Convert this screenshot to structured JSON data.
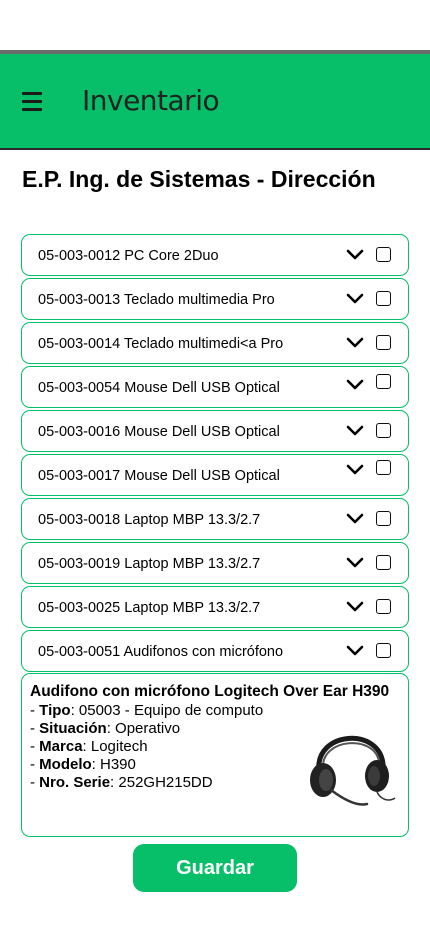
{
  "app": {
    "title": "Inventario"
  },
  "page": {
    "title": "E.P. Ing. de Sistemas - Dirección"
  },
  "items": [
    {
      "label": "05-003-0012 PC Core 2Duo"
    },
    {
      "label": "05-003-0013 Teclado multimedia Pro"
    },
    {
      "label": "05-003-0014 Teclado multimedi<a Pro"
    },
    {
      "label": "05-003-0054 Mouse Dell USB Optical"
    },
    {
      "label": "05-003-0016 Mouse Dell USB Optical"
    },
    {
      "label": "05-003-0017 Mouse Dell USB Optical"
    },
    {
      "label": "05-003-0018 Laptop MBP 13.3/2.7"
    },
    {
      "label": "05-003-0019 Laptop MBP 13.3/2.7"
    },
    {
      "label": "05-003-0025 Laptop MBP 13.3/2.7"
    },
    {
      "label": "05-003-0051 Audifonos con micrófono"
    }
  ],
  "detail": {
    "title": "Audifono con micrófono Logitech Over Ear H390",
    "attributes": [
      {
        "key": "Tipo",
        "value": ": 05003 - Equipo de computo"
      },
      {
        "key": "Situación",
        "value": ": Operativo"
      },
      {
        "key": "Marca",
        "value": ": Logitech"
      },
      {
        "key": "Modelo",
        "value": ": H390"
      },
      {
        "key": "Nro. Serie",
        "value": ": 252GH215DD"
      }
    ]
  },
  "actions": {
    "save_label": "Guardar"
  },
  "colors": {
    "accent": "#07bf68",
    "appbar_border": "#2a2a2a"
  }
}
